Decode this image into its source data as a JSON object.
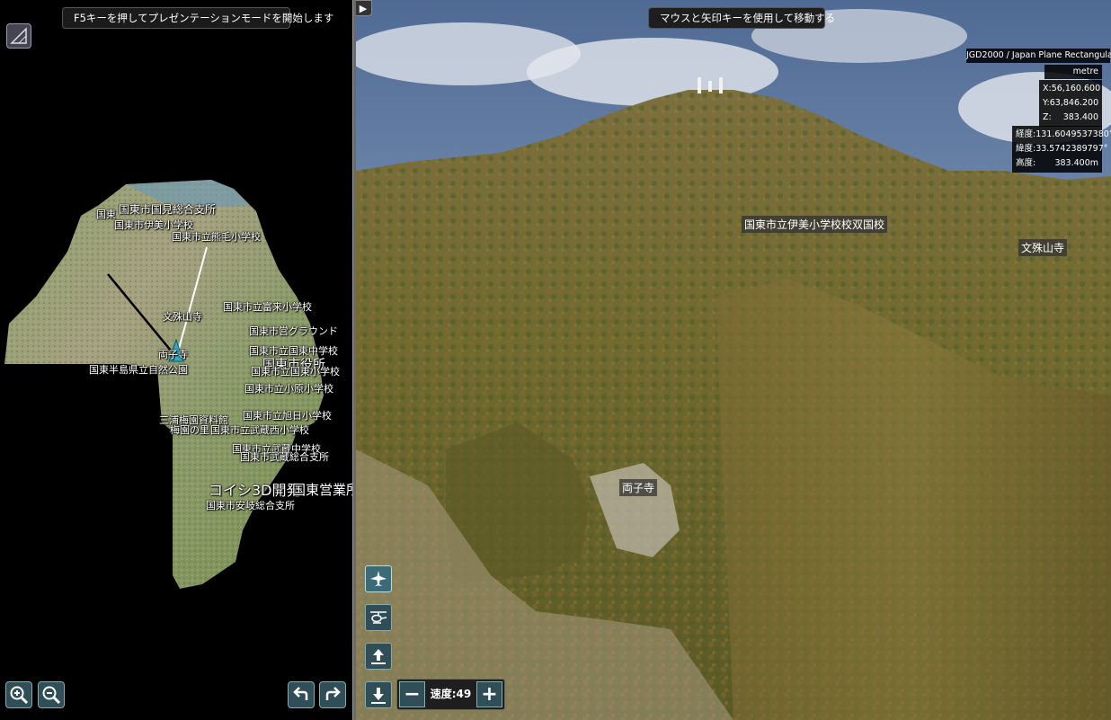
{
  "map_panel": {
    "banner": "F5キーを押してプレゼンテーションモードを開始します",
    "labels": [
      "国東市国見総合支所",
      "国東市伊美小学校",
      "国東市立熊毛小学校",
      "国東市立富来小学校",
      "文殊山寺",
      "国東市営グラウンド",
      "両子寺",
      "国東市立国東中学校",
      "国東半島県立自然公園",
      "国東市役所",
      "国東市立国東小学校",
      "国東市立小原小学校",
      "国東市立旭日小学校",
      "三浦梅園資料館",
      "梅園の里",
      "国東市立武蔵西小学校",
      "国東市立武蔵中学校",
      "国東市武蔵総合支所",
      "コイシ3D開発",
      "国東営業所",
      "国東市安岐総合支所",
      "国東市立伊美小学校",
      "国東"
    ]
  },
  "scene_panel": {
    "banner": "マウスと矢印キーを使用して移動する",
    "labels": {
      "school": "国東市立伊美小学校校双国校",
      "temple_right": "文殊山寺",
      "temple_center": "両子寺"
    }
  },
  "coordinates": {
    "crs": "JGD2000 / Japan Plane Rectangular CS II",
    "unit": "metre",
    "x_label": "X:",
    "x": "56,160.600",
    "y_label": "Y:",
    "y": "63,846.200",
    "z_label": "Z:",
    "z": "383.400",
    "lon_label": "経度:",
    "lon": "131.6049537380°",
    "lat_label": "緯度:",
    "lat": "33.5742389797°",
    "alt_label": "高度:",
    "alt": "383.400m"
  },
  "controls": {
    "speed_label": "速度:49",
    "minus": "−",
    "plus": "+",
    "icons": [
      "draw-tool-icon",
      "zoom-in-icon",
      "zoom-out-icon",
      "undo-arrow-icon",
      "redo-arrow-icon",
      "airplane-icon",
      "helicopter-icon",
      "move-up-icon",
      "move-down-icon",
      "nav-left-icon",
      "nav-right-icon"
    ]
  }
}
